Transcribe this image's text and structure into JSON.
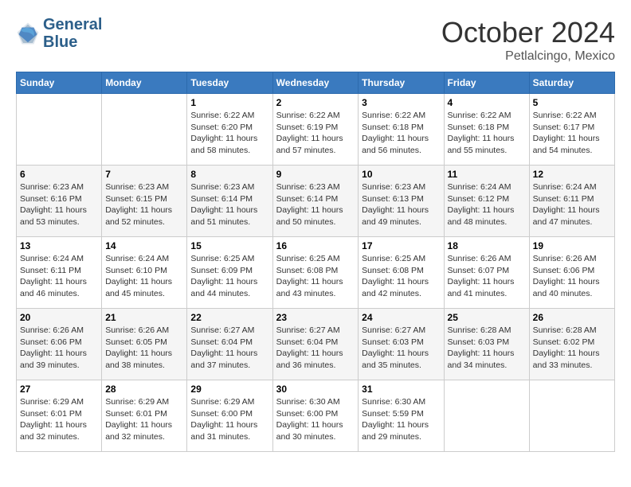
{
  "header": {
    "logo_line1": "General",
    "logo_line2": "Blue",
    "month": "October 2024",
    "location": "Petlalcingo, Mexico"
  },
  "weekdays": [
    "Sunday",
    "Monday",
    "Tuesday",
    "Wednesday",
    "Thursday",
    "Friday",
    "Saturday"
  ],
  "rows": [
    [
      {
        "day": "",
        "text": ""
      },
      {
        "day": "",
        "text": ""
      },
      {
        "day": "1",
        "text": "Sunrise: 6:22 AM\nSunset: 6:20 PM\nDaylight: 11 hours and 58 minutes."
      },
      {
        "day": "2",
        "text": "Sunrise: 6:22 AM\nSunset: 6:19 PM\nDaylight: 11 hours and 57 minutes."
      },
      {
        "day": "3",
        "text": "Sunrise: 6:22 AM\nSunset: 6:18 PM\nDaylight: 11 hours and 56 minutes."
      },
      {
        "day": "4",
        "text": "Sunrise: 6:22 AM\nSunset: 6:18 PM\nDaylight: 11 hours and 55 minutes."
      },
      {
        "day": "5",
        "text": "Sunrise: 6:22 AM\nSunset: 6:17 PM\nDaylight: 11 hours and 54 minutes."
      }
    ],
    [
      {
        "day": "6",
        "text": "Sunrise: 6:23 AM\nSunset: 6:16 PM\nDaylight: 11 hours and 53 minutes."
      },
      {
        "day": "7",
        "text": "Sunrise: 6:23 AM\nSunset: 6:15 PM\nDaylight: 11 hours and 52 minutes."
      },
      {
        "day": "8",
        "text": "Sunrise: 6:23 AM\nSunset: 6:14 PM\nDaylight: 11 hours and 51 minutes."
      },
      {
        "day": "9",
        "text": "Sunrise: 6:23 AM\nSunset: 6:14 PM\nDaylight: 11 hours and 50 minutes."
      },
      {
        "day": "10",
        "text": "Sunrise: 6:23 AM\nSunset: 6:13 PM\nDaylight: 11 hours and 49 minutes."
      },
      {
        "day": "11",
        "text": "Sunrise: 6:24 AM\nSunset: 6:12 PM\nDaylight: 11 hours and 48 minutes."
      },
      {
        "day": "12",
        "text": "Sunrise: 6:24 AM\nSunset: 6:11 PM\nDaylight: 11 hours and 47 minutes."
      }
    ],
    [
      {
        "day": "13",
        "text": "Sunrise: 6:24 AM\nSunset: 6:11 PM\nDaylight: 11 hours and 46 minutes."
      },
      {
        "day": "14",
        "text": "Sunrise: 6:24 AM\nSunset: 6:10 PM\nDaylight: 11 hours and 45 minutes."
      },
      {
        "day": "15",
        "text": "Sunrise: 6:25 AM\nSunset: 6:09 PM\nDaylight: 11 hours and 44 minutes."
      },
      {
        "day": "16",
        "text": "Sunrise: 6:25 AM\nSunset: 6:08 PM\nDaylight: 11 hours and 43 minutes."
      },
      {
        "day": "17",
        "text": "Sunrise: 6:25 AM\nSunset: 6:08 PM\nDaylight: 11 hours and 42 minutes."
      },
      {
        "day": "18",
        "text": "Sunrise: 6:26 AM\nSunset: 6:07 PM\nDaylight: 11 hours and 41 minutes."
      },
      {
        "day": "19",
        "text": "Sunrise: 6:26 AM\nSunset: 6:06 PM\nDaylight: 11 hours and 40 minutes."
      }
    ],
    [
      {
        "day": "20",
        "text": "Sunrise: 6:26 AM\nSunset: 6:06 PM\nDaylight: 11 hours and 39 minutes."
      },
      {
        "day": "21",
        "text": "Sunrise: 6:26 AM\nSunset: 6:05 PM\nDaylight: 11 hours and 38 minutes."
      },
      {
        "day": "22",
        "text": "Sunrise: 6:27 AM\nSunset: 6:04 PM\nDaylight: 11 hours and 37 minutes."
      },
      {
        "day": "23",
        "text": "Sunrise: 6:27 AM\nSunset: 6:04 PM\nDaylight: 11 hours and 36 minutes."
      },
      {
        "day": "24",
        "text": "Sunrise: 6:27 AM\nSunset: 6:03 PM\nDaylight: 11 hours and 35 minutes."
      },
      {
        "day": "25",
        "text": "Sunrise: 6:28 AM\nSunset: 6:03 PM\nDaylight: 11 hours and 34 minutes."
      },
      {
        "day": "26",
        "text": "Sunrise: 6:28 AM\nSunset: 6:02 PM\nDaylight: 11 hours and 33 minutes."
      }
    ],
    [
      {
        "day": "27",
        "text": "Sunrise: 6:29 AM\nSunset: 6:01 PM\nDaylight: 11 hours and 32 minutes."
      },
      {
        "day": "28",
        "text": "Sunrise: 6:29 AM\nSunset: 6:01 PM\nDaylight: 11 hours and 32 minutes."
      },
      {
        "day": "29",
        "text": "Sunrise: 6:29 AM\nSunset: 6:00 PM\nDaylight: 11 hours and 31 minutes."
      },
      {
        "day": "30",
        "text": "Sunrise: 6:30 AM\nSunset: 6:00 PM\nDaylight: 11 hours and 30 minutes."
      },
      {
        "day": "31",
        "text": "Sunrise: 6:30 AM\nSunset: 5:59 PM\nDaylight: 11 hours and 29 minutes."
      },
      {
        "day": "",
        "text": ""
      },
      {
        "day": "",
        "text": ""
      }
    ]
  ]
}
